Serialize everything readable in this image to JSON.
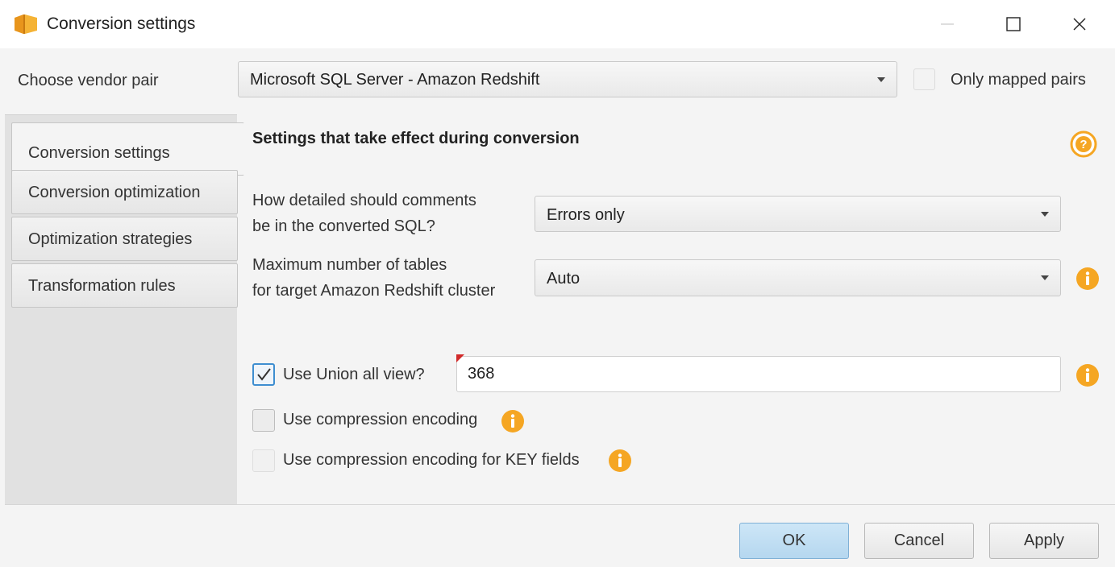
{
  "window": {
    "title": "Conversion settings",
    "app_icon": "aws-sct-cube-icon"
  },
  "vendor": {
    "label": "Choose vendor pair",
    "selected": "Microsoft SQL Server - Amazon Redshift",
    "only_mapped_label": "Only mapped pairs",
    "only_mapped_checked": false
  },
  "nav": {
    "items": [
      {
        "label": "Conversion settings",
        "active": true
      },
      {
        "label": "Conversion optimization",
        "active": false
      },
      {
        "label": "Optimization strategies",
        "active": false
      },
      {
        "label": "Transformation rules",
        "active": false
      }
    ]
  },
  "content": {
    "section_title": "Settings that take effect during conversion",
    "comments": {
      "label_line1": "How detailed should comments",
      "label_line2": "be in the converted SQL?",
      "value": "Errors only"
    },
    "tables": {
      "label_line1": "Maximum number of tables",
      "label_line2": "for target Amazon Redshift cluster",
      "value": "Auto"
    },
    "union_all": {
      "label": "Use Union all view?",
      "checked": true,
      "value": "368"
    },
    "compression": {
      "label": "Use compression encoding",
      "checked": false
    },
    "compression_key": {
      "label": "Use compression encoding for KEY fields",
      "checked": false,
      "disabled": true
    }
  },
  "buttons": {
    "ok": "OK",
    "cancel": "Cancel",
    "apply": "Apply"
  },
  "colors": {
    "accent_orange": "#f5a623",
    "ok_blue": "#b5d7ef",
    "check_blue": "#3e8ed0"
  }
}
